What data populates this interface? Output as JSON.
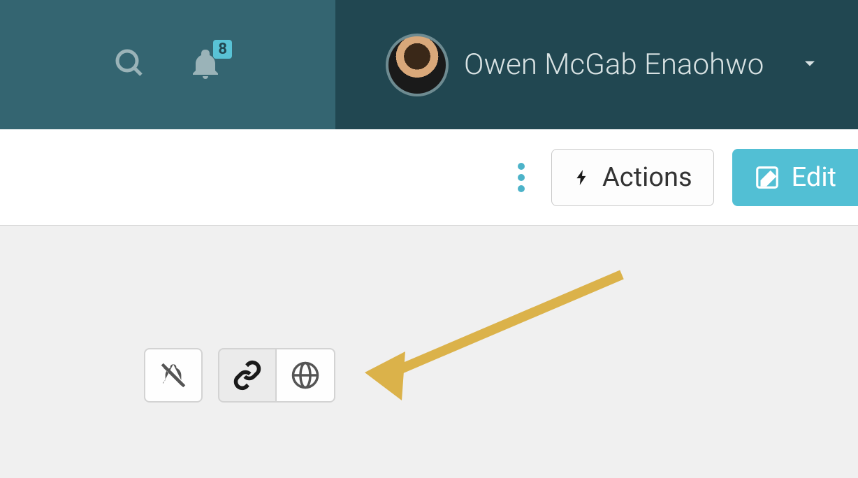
{
  "header": {
    "notification_count": "8",
    "user_name": "Owen McGab Enaohwo"
  },
  "toolbar": {
    "actions_label": "Actions",
    "edit_label": "Edit"
  },
  "icons": {
    "search": "search-icon",
    "bell": "bell-icon",
    "chevron": "chevron-down-icon",
    "kebab": "more-options-icon",
    "bolt": "lightning-icon",
    "edit": "pencil-square-icon",
    "mute": "bell-slash-icon",
    "link": "link-icon",
    "globe": "globe-icon"
  },
  "colors": {
    "header_left": "#346571",
    "header_right": "#214751",
    "accent": "#52bfd4",
    "arrow": "#dbb24a"
  }
}
